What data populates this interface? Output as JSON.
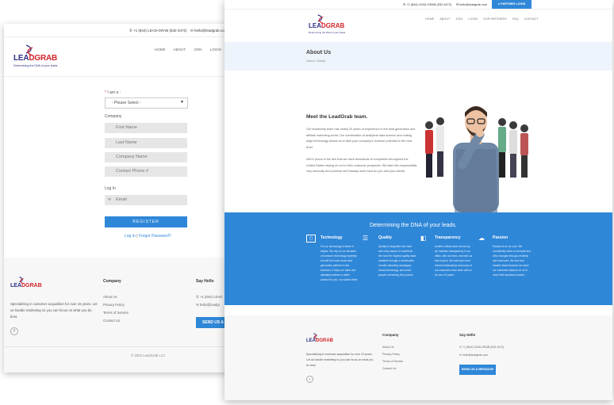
{
  "brand": {
    "name_a": "LEA",
    "name_b": "DGRAB",
    "tagline": "Determining the DNA of your leads",
    "primary_color": "#2f87d8",
    "logo_red": "#d2232a",
    "logo_navy": "#2b2e83"
  },
  "win1": {
    "topbar": {
      "phone": "+1 (844) LEAD-GRAB (532-3472)",
      "email": "hello@leadgrab.com"
    },
    "nav": [
      "HOME",
      "ABOUT",
      "JOIN",
      "LOGIN"
    ],
    "form": {
      "iam_label": "I am a",
      "select_value": "- Please Select -",
      "company_label": "Company",
      "fields": [
        "First Name",
        "Last Name",
        "Company Name",
        "Contact Phone #"
      ],
      "login_label": "Log In",
      "email_placeholder": "Email",
      "register_label": "REGISTER",
      "login_link": "Log In",
      "sep": "|",
      "forgot_link": "Forgot Password?"
    },
    "footer": {
      "desc": "Specializing in customer acquisition for over 15 years. Let us handle marketing so you can focus on what you do best.",
      "company_title": "Company",
      "company_links": [
        "About Us",
        "Privacy Policy",
        "Terms of Service",
        "Contact Us"
      ],
      "say_hello_title": "Say Hello",
      "phone": "+1 (844) LEAD",
      "email": "hello@leadgr",
      "send_btn": "SEND US A MES",
      "copyright": "© 2022 LeadGrab LLC"
    }
  },
  "win2": {
    "topbar": {
      "phone": "+1 (844) LEAD-GRAB (532-3472)",
      "email": "hello@leadgrab.com",
      "partner_btn": "PARTNER LOGIN"
    },
    "nav": [
      "HOME",
      "ABOUT",
      "JOIN",
      "LOGIN",
      "OUR PARTNERS",
      "FAQ",
      "CONTACT"
    ],
    "page_title": "About Us",
    "breadcrumb": "Home / About",
    "intro_title": "Meet the LeadGrab team.",
    "intro_p1": "Our leadership team has nearly 20 years of experience in the lead generation and affiliate marketing world. Our combination of analytical data science and cutting edge technology allows us to take your company's revenue potential to the next level.",
    "intro_p2": "We're proud of the fact that we have thousands of companies throughout the United States relying on us for their customer prospects. We take this responsibility very seriously and promise we'll always work hard for you and your clients.",
    "band_title": "Determining the DNA of your leads.",
    "features": [
      {
        "icon": "technology-icon",
        "title": "Technology",
        "text": "For us, technology is where it begins. We rely on our decades of hardcore technology expertise to build the most robust lead generation platform in the business. It helps our team and ultimately delivers a better product for you, our valued client."
      },
      {
        "icon": "quality-icon",
        "title": "Quality",
        "text": "Quality is integrated into each and every aspect of LeadGrab. We have the highest quality leads available through a combination of solid marketing campaigns, robust technology, and smart people overseeing the process."
      },
      {
        "icon": "transparency-icon",
        "title": "Transparency",
        "text": "Another critical value we live by, we maintain transparency in our office, with our team, and with our lead buyers. We build open and honest relationships and many of our customers have been with us for over 10 years."
      },
      {
        "icon": "passion-icon",
        "title": "Passion",
        "text": "Passion is at our core. We consistently strive to innovate and drive changes through creativity and hard work. We love and breathe leads because we know our customers depend on us to move their business forward."
      }
    ],
    "footer": {
      "desc": "Specializing in customer acquisition for over 15 years. Let us handle marketing so you can focus on what you do best.",
      "company_title": "Company",
      "company_links": [
        "About Us",
        "Privacy Policy",
        "Terms of Service",
        "Contact Us"
      ],
      "say_hello_title": "Say Hello",
      "phone": "+1 (844) LEAD-GRAB (532-3472)",
      "email": "hello@leadgrab.com",
      "send_btn": "SEND US A MESSAGE"
    }
  }
}
